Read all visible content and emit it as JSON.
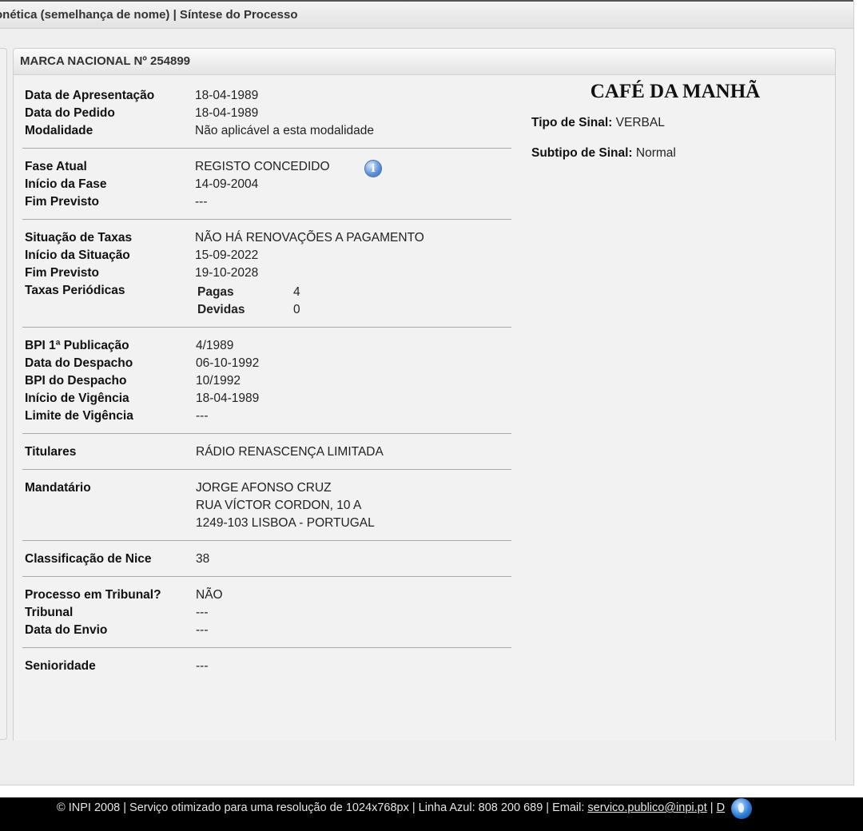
{
  "breadcrumb": "onética (semelhança de nome) | Síntese do Processo",
  "panel_title": "MARCA NACIONAL Nº 254899",
  "groups": [
    {
      "rows": [
        {
          "label": "Data de Apresentação",
          "value": "18-04-1989"
        },
        {
          "label": "Data do Pedido",
          "value": "18-04-1989"
        },
        {
          "label": "Modalidade",
          "value": "Não aplicável a esta modalidade"
        }
      ]
    },
    {
      "rows": [
        {
          "label": "Fase Atual",
          "value": "REGISTO CONCEDIDO"
        },
        {
          "label": "Início da Fase",
          "value": "14-09-2004"
        },
        {
          "label": "Fim Previsto",
          "value": "---"
        }
      ]
    },
    {
      "rows": [
        {
          "label": "Situação de Taxas",
          "value": "NÃO HÁ RENOVAÇÕES A PAGAMENTO"
        },
        {
          "label": "Início da Situação",
          "value": "15-09-2022"
        },
        {
          "label": "Fim Previsto",
          "value": "19-10-2028"
        },
        {
          "label": "Taxas Periódicas",
          "value": ""
        }
      ],
      "taxas": [
        {
          "label": "Pagas",
          "value": "4"
        },
        {
          "label": "Devidas",
          "value": "0"
        }
      ]
    },
    {
      "rows": [
        {
          "label": "BPI 1ª Publicação",
          "value": "4/1989"
        },
        {
          "label": "Data do Despacho",
          "value": "06-10-1992"
        },
        {
          "label": "BPI do Despacho",
          "value": "10/1992"
        },
        {
          "label": "Início de Vigência",
          "value": "18-04-1989"
        },
        {
          "label": "Limite de Vigência",
          "value": "---"
        }
      ]
    },
    {
      "rows": [
        {
          "label": "Titulares",
          "value": "RÁDIO RENASCENÇA LIMITADA"
        }
      ]
    },
    {
      "rows": [
        {
          "label": "Mandatário",
          "value": "JORGE AFONSO CRUZ"
        },
        {
          "label": "",
          "value": "RUA VÍCTOR CORDON, 10 A"
        },
        {
          "label": "",
          "value": "1249-103 LISBOA - PORTUGAL"
        }
      ]
    },
    {
      "rows": [
        {
          "label": "Classificação de Nice",
          "value": "38"
        }
      ]
    },
    {
      "rows": [
        {
          "label": "Processo em Tribunal?",
          "value": "NÃO"
        },
        {
          "label": "Tribunal",
          "value": "---"
        },
        {
          "label": "Data do Envio",
          "value": "---"
        }
      ]
    },
    {
      "rows": [
        {
          "label": "Senioridade",
          "value": "---"
        }
      ]
    }
  ],
  "sign": {
    "name": "CAFÉ DA MANHÃ",
    "tipo_label": "Tipo de Sinal:",
    "tipo_value": "VERBAL",
    "subtipo_label": "Subtipo de Sinal:",
    "subtipo_value": "Normal"
  },
  "footer": {
    "text": "© INPI 2008 | Serviço otimizado para uma resolução de 1024x768px | Linha Azul: 808 200 689 | Email: ",
    "email": "servico.publico@inpi.pt",
    "sep": " | ",
    "tail_link": "D"
  },
  "icons": {
    "info": "info-icon",
    "globe": "globe-icon"
  }
}
